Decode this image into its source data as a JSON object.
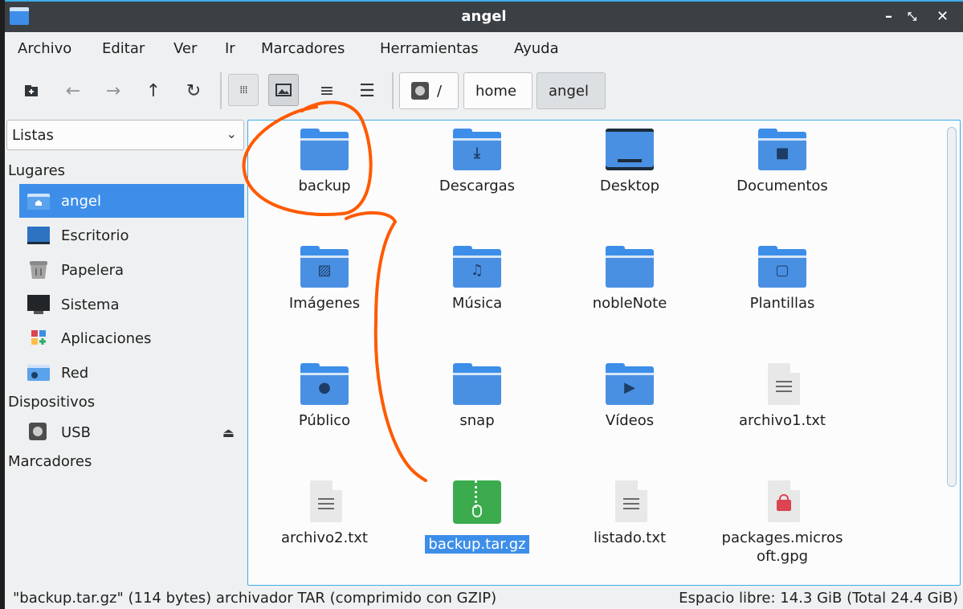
{
  "window": {
    "title": "angel"
  },
  "menubar": [
    "Archivo",
    "Editar",
    "Ver",
    "Ir",
    "Marcadores",
    "Herramientas",
    "Ayuda"
  ],
  "breadcrumb": {
    "root": "/",
    "parts": [
      "home",
      "angel"
    ]
  },
  "sidebar": {
    "mode": "Listas",
    "places_header": "Lugares",
    "places": [
      {
        "label": "angel",
        "icon": "home-folder-icon",
        "selected": true
      },
      {
        "label": "Escritorio",
        "icon": "desktop-icon"
      },
      {
        "label": "Papelera",
        "icon": "trash-icon"
      },
      {
        "label": "Sistema",
        "icon": "computer-icon"
      },
      {
        "label": "Aplicaciones",
        "icon": "applications-icon"
      },
      {
        "label": "Red",
        "icon": "network-folder-icon"
      }
    ],
    "devices_header": "Dispositivos",
    "devices": [
      {
        "label": "USB",
        "icon": "drive-icon"
      }
    ],
    "bookmarks_header": "Marcadores"
  },
  "files": [
    {
      "name": "backup",
      "kind": "folder",
      "glyph": ""
    },
    {
      "name": "Descargas",
      "kind": "folder",
      "glyph": "⤓"
    },
    {
      "name": "Desktop",
      "kind": "desktop",
      "glyph": ""
    },
    {
      "name": "Documentos",
      "kind": "folder",
      "glyph": "■"
    },
    {
      "name": "Imágenes",
      "kind": "folder",
      "glyph": "▨"
    },
    {
      "name": "Música",
      "kind": "folder",
      "glyph": "♫"
    },
    {
      "name": "nobleNote",
      "kind": "folder",
      "glyph": ""
    },
    {
      "name": "Plantillas",
      "kind": "folder",
      "glyph": "▢"
    },
    {
      "name": "Público",
      "kind": "folder",
      "glyph": "●"
    },
    {
      "name": "snap",
      "kind": "folder",
      "glyph": ""
    },
    {
      "name": "Vídeos",
      "kind": "folder",
      "glyph": "▶"
    },
    {
      "name": "archivo1.txt",
      "kind": "text",
      "glyph": ""
    },
    {
      "name": "archivo2.txt",
      "kind": "text",
      "glyph": ""
    },
    {
      "name": "backup.tar.gz",
      "kind": "zip",
      "glyph": "",
      "selected": true
    },
    {
      "name": "listado.txt",
      "kind": "text",
      "glyph": ""
    },
    {
      "name": "packages.microsoft.gpg",
      "kind": "key",
      "glyph": ""
    }
  ],
  "status": {
    "selection": "\"backup.tar.gz\" (114 bytes) archivador TAR (comprimido con GZIP)",
    "free_space": "Espacio libre: 14.3 GiB (Total 24.4 GiB)"
  },
  "colors": {
    "accent": "#3d8ee9",
    "titlebar": "#3b4045",
    "annotation": "#ff5a00"
  }
}
